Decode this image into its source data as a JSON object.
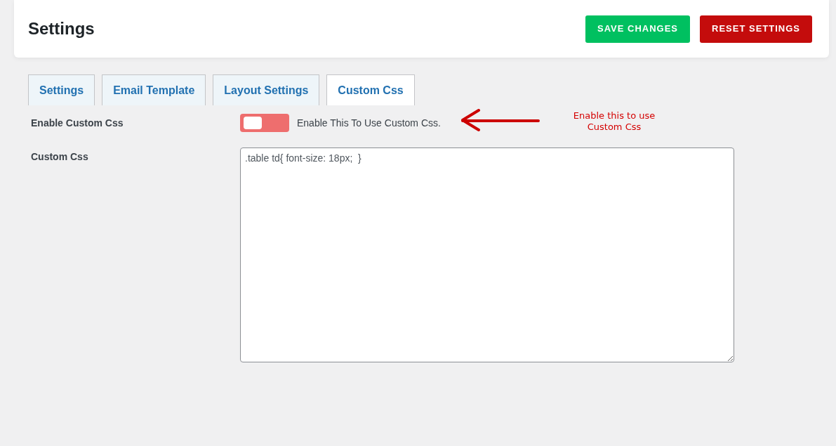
{
  "header": {
    "title": "Settings",
    "buttons": [
      {
        "label": "SAVE CHANGES",
        "kind": "save"
      },
      {
        "label": "RESET SETTINGS",
        "kind": "reset"
      }
    ]
  },
  "tabs": [
    {
      "label": "Settings",
      "selected": false
    },
    {
      "label": "Email Template",
      "selected": false
    },
    {
      "label": "Layout Settings",
      "selected": false
    },
    {
      "label": "Custom Css",
      "selected": true
    }
  ],
  "fields": [
    {
      "kind": "toggle",
      "label": "Enable Custom Css",
      "on": false,
      "description": "Enable This To Use Custom Css."
    },
    {
      "kind": "textarea",
      "label": "Custom Css",
      "value": ".table td{ font-size: 18px;  }"
    }
  ],
  "annotation": {
    "text": "Enable this to use Custom Css"
  }
}
